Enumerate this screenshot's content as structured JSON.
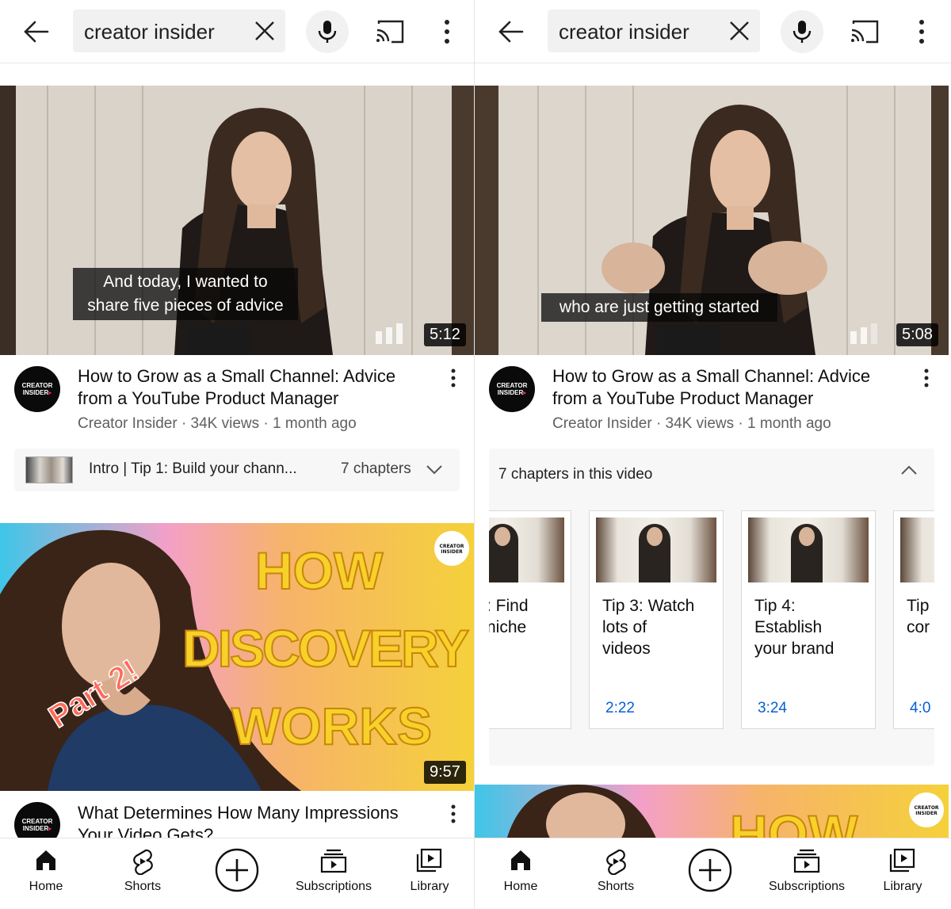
{
  "search": {
    "query": "creator insider"
  },
  "left": {
    "video1": {
      "caption_line1": "And today, I wanted to",
      "caption_line2": "share five pieces of advice",
      "duration": "5:12",
      "title_line1": "How to Grow as a Small Channel: Advice",
      "title_line2": "from a YouTube Product Manager",
      "meta": "Creator Insider · 34K views · 1 month ago"
    },
    "chapters": {
      "current": "Intro | Tip 1: Build your chann...",
      "count": "7 chapters"
    },
    "video2": {
      "thumb_word1": "HOW",
      "thumb_word2": "DISCOVERY",
      "thumb_word3": "WORKS",
      "thumb_badge": "Part 2!",
      "duration": "9:57",
      "title_line1": "What Determines How Many Impressions",
      "title_line2": "Your Video Gets?"
    }
  },
  "right": {
    "video1": {
      "caption": "who are just getting started",
      "duration": "5:08",
      "title_line1": "How to Grow as a Small Channel: Advice",
      "title_line2": "from a YouTube Product Manager",
      "meta": "Creator Insider · 34K views · 1 month ago"
    },
    "chapters": {
      "heading": "7 chapters in this video",
      "cards": [
        {
          "title_line1": ": Find",
          "title_line2": "niche",
          "title_line3": "",
          "time": ""
        },
        {
          "title_line1": "Tip 3: Watch",
          "title_line2": "lots of",
          "title_line3": "videos",
          "time": "2:22"
        },
        {
          "title_line1": "Tip 4:",
          "title_line2": "Establish",
          "title_line3": "your brand",
          "time": "3:24"
        },
        {
          "title_line1": "Tip",
          "title_line2": "cor",
          "title_line3": "",
          "time": "4:0"
        }
      ]
    },
    "video2": {
      "thumb_word1": "HOW"
    }
  },
  "channel": {
    "avatar_line1": "CREATOR",
    "avatar_line2": "INSIDER"
  },
  "nav": {
    "home": "Home",
    "shorts": "Shorts",
    "subscriptions": "Subscriptions",
    "library": "Library"
  },
  "colors": {
    "link_blue": "#065fd4",
    "meta_gray": "#606060",
    "search_bg": "#f1f1f1"
  }
}
